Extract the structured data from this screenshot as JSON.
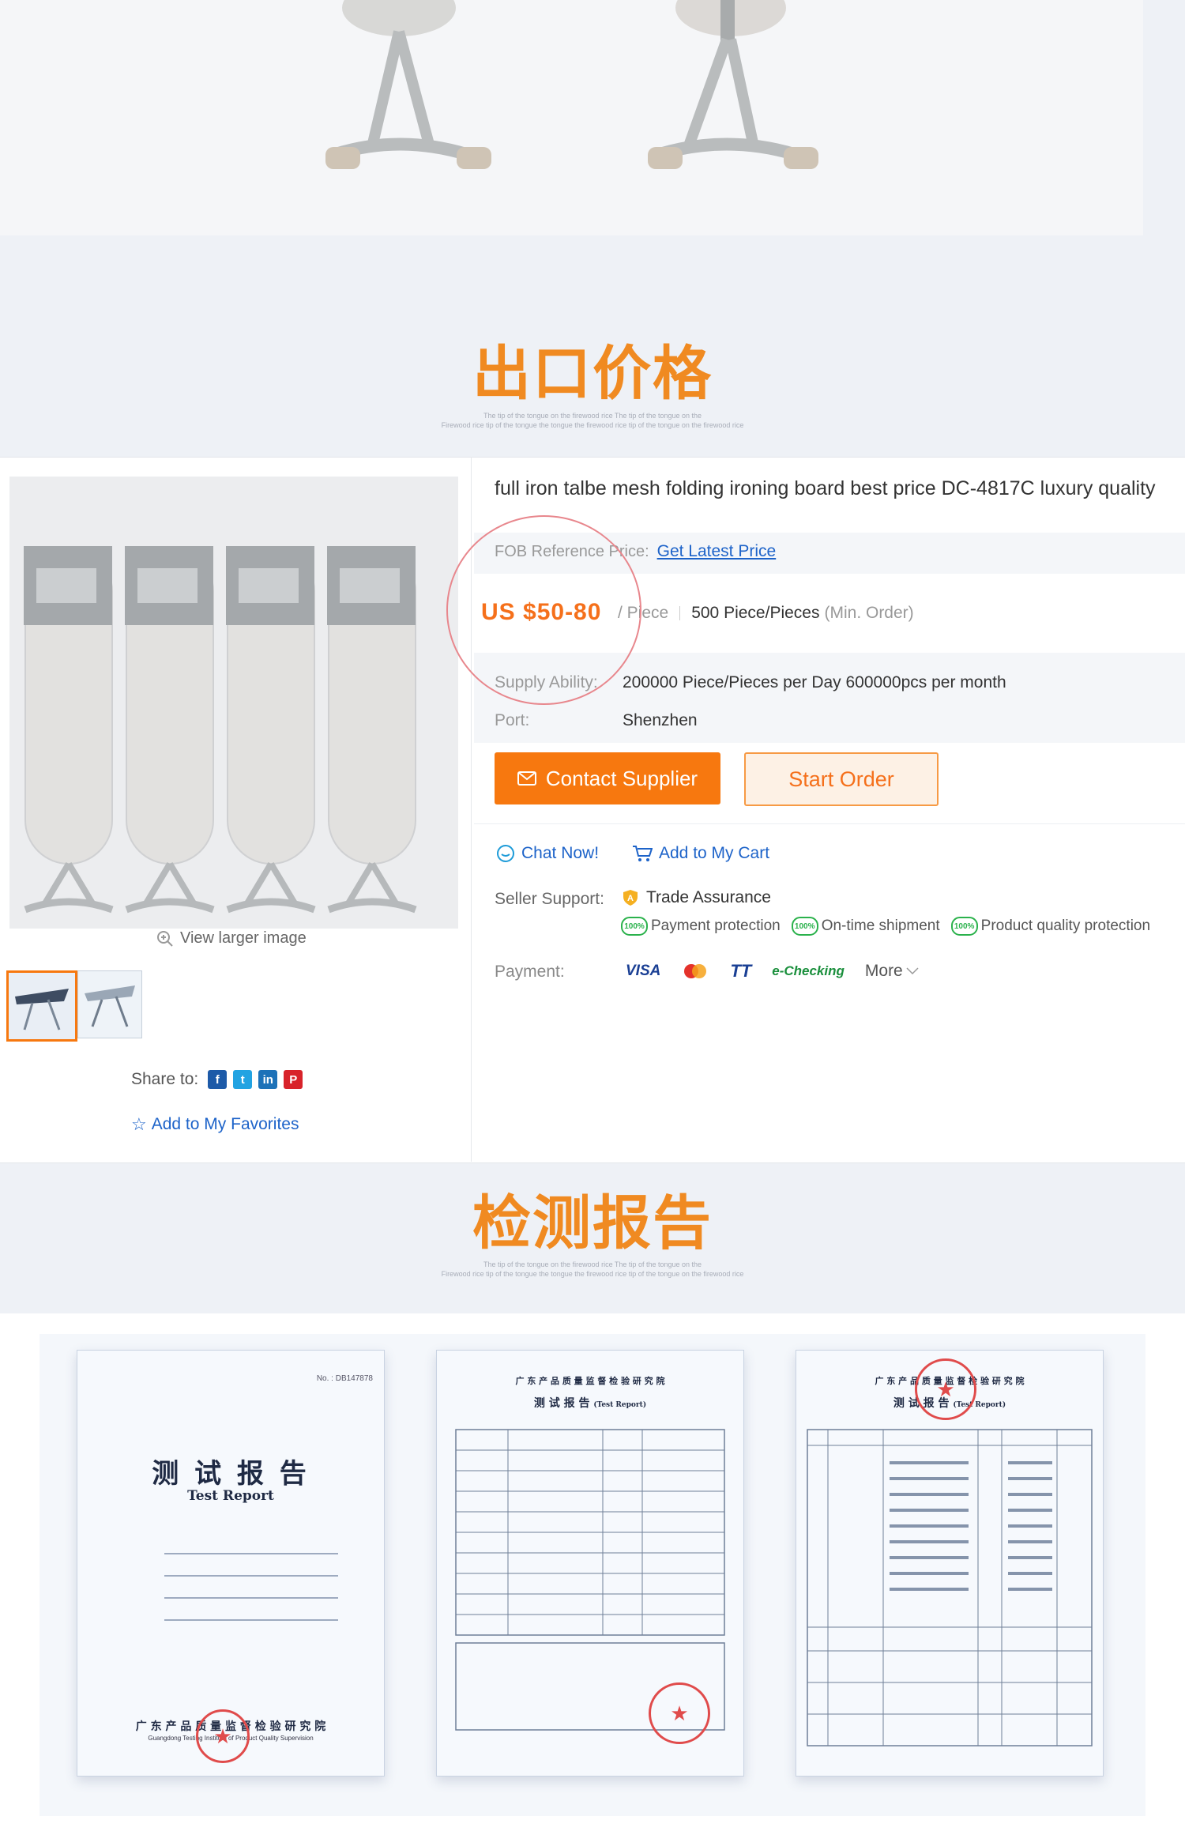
{
  "sections": {
    "price_title": "出口价格",
    "price_subtitle_line1": "The tip of the tongue on the firewood rice The tip of the tongue on the",
    "price_subtitle_line2": "Firewood rice tip of the tongue the tongue the firewood rice tip of the tongue on the firewood rice",
    "report_title": "检测报告",
    "report_subtitle_line1": "The tip of the tongue on the firewood rice The tip of the tongue on the",
    "report_subtitle_line2": "Firewood rice tip of the tongue the tongue the firewood rice tip of the tongue on the firewood rice"
  },
  "gallery": {
    "view_larger": "View larger image",
    "share_label": "Share to:",
    "add_favorites": "Add to My Favorites",
    "share_icons": [
      "facebook-icon",
      "twitter-icon",
      "linkedin-icon",
      "pinterest-icon"
    ]
  },
  "product": {
    "title": "full iron talbe mesh folding ironing board best price DC-4817C luxury quality",
    "fob_label": "FOB Reference Price:",
    "fob_link": "Get Latest Price",
    "price": "US $50-80",
    "price_unit": "/ Piece",
    "moq": "500 Piece/Pieces",
    "moq_suffix": "(Min. Order)",
    "supply_label": "Supply Ability:",
    "supply_value": "200000 Piece/Pieces per Day 600000pcs per month",
    "port_label": "Port:",
    "port_value": "Shenzhen",
    "contact_btn": "Contact Supplier",
    "order_btn": "Start Order",
    "chat_now": "Chat Now!",
    "add_cart": "Add to My Cart",
    "seller_support_label": "Seller Support:",
    "trade_assurance": "Trade Assurance",
    "guarantees": [
      "Payment protection",
      "On-time shipment",
      "Product quality protection"
    ],
    "badge_text": "100%",
    "payment_label": "Payment:",
    "payment_methods": [
      "VISA",
      "TT",
      "e-Checking"
    ],
    "more": "More"
  },
  "reports": {
    "doc1_title": "测 试 报 告",
    "doc1_subtitle": "Test Report",
    "doc1_no": "No. : DB147878",
    "doc1_footer": "广 东 产 品 质 量 监 督 检 验 研 究 院",
    "doc1_footer_en": "Guangdong Testing Institute of Product Quality Supervision",
    "doc2_header": "广 东 产 品 质 量 监 督 检 验 研 究 院",
    "doc2_title": "测 试 报 告",
    "doc2_title_en": "(Test Report)",
    "doc3_header": "广 东 产 品 质 量 监 督 检 验 研 究 院",
    "doc3_title": "测 试 报 告",
    "doc3_title_en": "(Test Report)"
  },
  "colors": {
    "accent_orange": "#f08a21",
    "button_orange": "#f7780f",
    "link_blue": "#1d63c9",
    "assurance_green": "#2bb24c",
    "annotation_pink": "#e8878d"
  }
}
